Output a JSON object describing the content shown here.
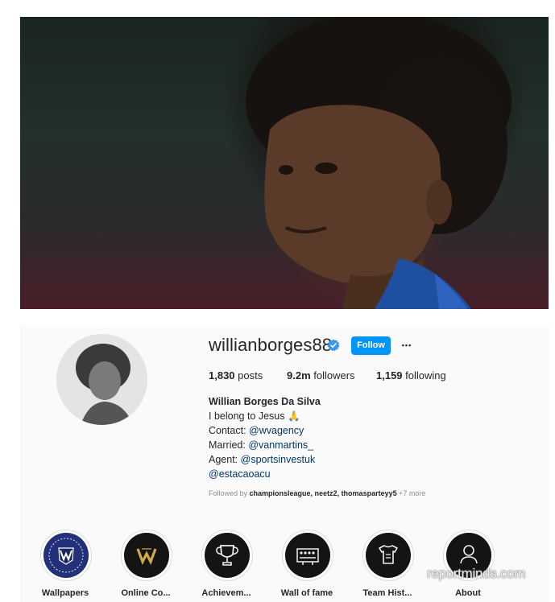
{
  "profile": {
    "username": "willianborges88",
    "follow_label": "Follow",
    "more_label": "•••",
    "stats": {
      "posts_count": "1,830",
      "posts_label": "posts",
      "followers_count": "9.2m",
      "followers_label": "followers",
      "following_count": "1,159",
      "following_label": "following"
    },
    "bio": {
      "full_name": "Willian Borges Da Silva",
      "line1": "I belong to Jesus 🙏",
      "contact_label": "Contact: ",
      "contact_handle": "@wvagency",
      "married_label": "Married: ",
      "married_handle": "@vanmartins_",
      "agent_label": "Agent: ",
      "agent_handle": "@sportsinvestuk",
      "extra_handle": "@estacaoacu"
    },
    "followed_by": {
      "prefix": "Followed by ",
      "names": "championsleague, neetz2, thomasparteyy5",
      "suffix": " +7 more"
    }
  },
  "highlights": [
    {
      "label": "Wallpapers",
      "icon": "w-shield-icon"
    },
    {
      "label": "Online Co...",
      "icon": "w-gold-logo-icon"
    },
    {
      "label": "Achievem...",
      "icon": "trophy-icon"
    },
    {
      "label": "Wall of fame",
      "icon": "team-photo-icon"
    },
    {
      "label": "Team Hist...",
      "icon": "jersey-icon"
    },
    {
      "label": "About",
      "icon": "person-icon"
    }
  ],
  "watermark": "reportminds.com",
  "colors": {
    "follow_button": "#0095f6",
    "link": "#00376b",
    "verified_badge": "#3897f0"
  }
}
